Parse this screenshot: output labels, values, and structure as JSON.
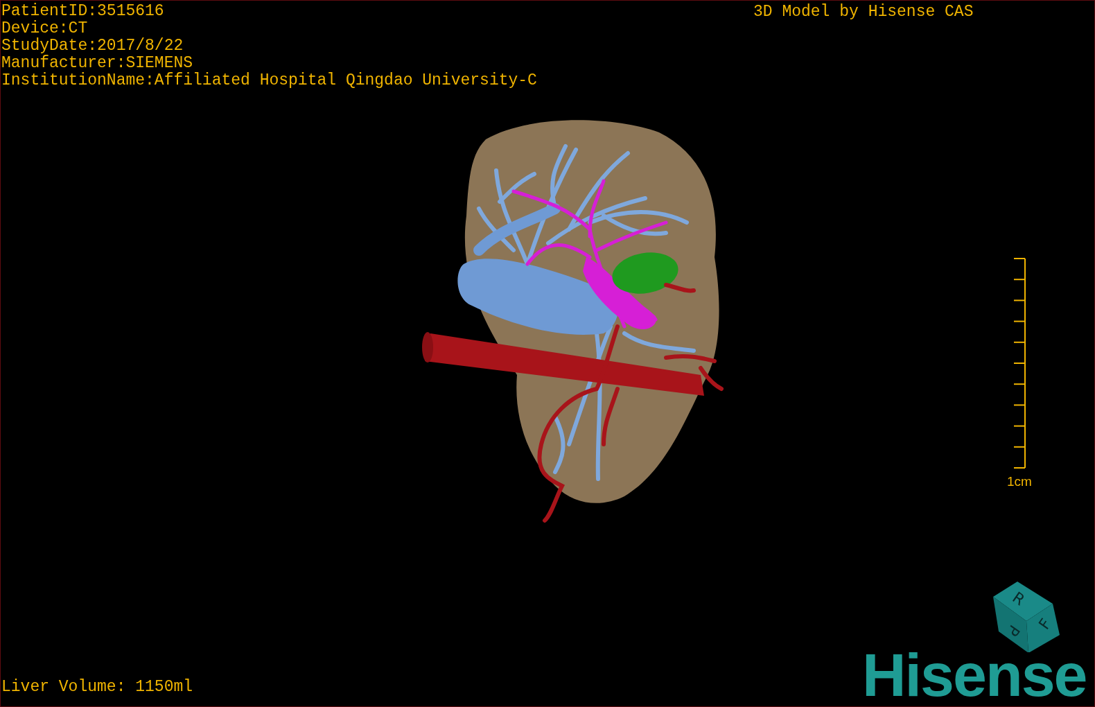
{
  "info_lines": [
    "PatientID:3515616",
    "Device:CT",
    "StudyDate:2017/8/22",
    "Manufacturer:SIEMENS",
    "InstitutionName:Affiliated Hospital Qingdao University-C"
  ],
  "title": "3D Model by Hisense CAS",
  "scale_bar": {
    "label": "1cm"
  },
  "orientation_cube": {
    "faces": [
      "R",
      "F",
      "P"
    ]
  },
  "logo": "Hisense",
  "footer": "Liver Volume: 1150ml"
}
